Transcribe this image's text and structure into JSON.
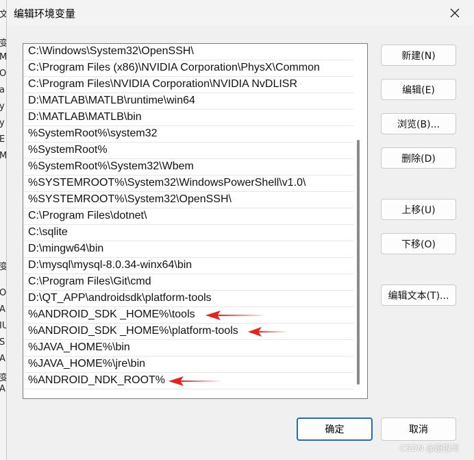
{
  "background_window": {
    "fragments": [
      "文",
      "变",
      "MO",
      "Or",
      "a",
      "y",
      "y",
      "E",
      "M",
      "变",
      "Or",
      "A",
      "IU",
      "S",
      "A",
      "变",
      "A"
    ]
  },
  "dialog": {
    "title": "编辑环境变量",
    "close_icon": "close-icon"
  },
  "paths": [
    "C:\\Windows\\System32\\OpenSSH\\",
    "C:\\Program Files (x86)\\NVIDIA Corporation\\PhysX\\Common",
    "C:\\Program Files\\NVIDIA Corporation\\NVIDIA NvDLISR",
    "D:\\MATLAB\\MATLB\\runtime\\win64",
    "D:\\MATLAB\\MATLB\\bin",
    "%SystemRoot%\\system32",
    "%SystemRoot%",
    "%SystemRoot%\\System32\\Wbem",
    "%SYSTEMROOT%\\System32\\WindowsPowerShell\\v1.0\\",
    "%SYSTEMROOT%\\System32\\OpenSSH\\",
    "C:\\Program Files\\dotnet\\",
    "C:\\sqlite",
    "D:\\mingw64\\bin",
    "D:\\mysql\\mysql-8.0.34-winx64\\bin",
    "C:\\Program Files\\Git\\cmd",
    "D:\\QT_APP\\androidsdk\\platform-tools",
    "%ANDROID_SDK _HOME%\\tools",
    "%ANDROID_SDK _HOME%\\platform-tools",
    "%JAVA_HOME%\\bin",
    "%JAVA_HOME%\\jre\\bin",
    "%ANDROID_NDK_ROOT%"
  ],
  "buttons": {
    "new": "新建(N)",
    "edit": "编辑(E)",
    "browse": "浏览(B)...",
    "delete": "删除(D)",
    "move_up": "上移(U)",
    "move_down": "下移(O)",
    "edit_text": "编辑文本(T)...",
    "ok": "确定",
    "cancel": "取消"
  },
  "annotation_color": "#e8231c",
  "watermark": "CSDN @超银河"
}
